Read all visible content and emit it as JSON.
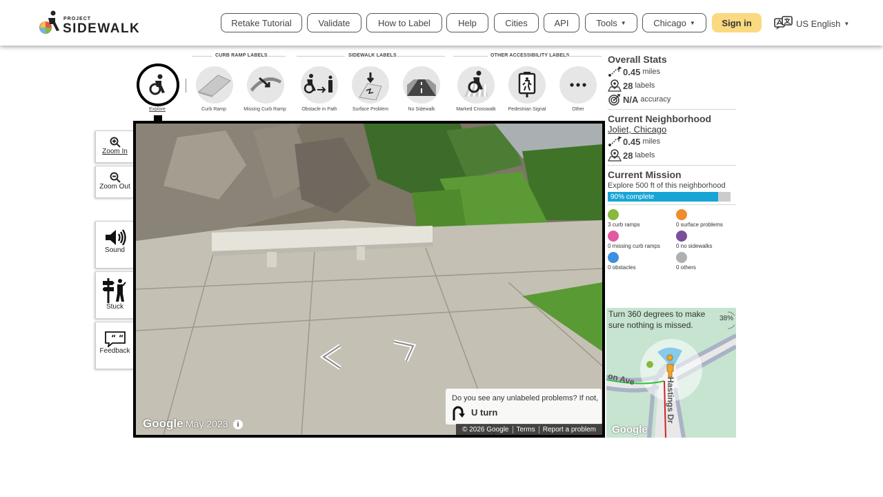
{
  "header": {
    "logo_small": "PROJECT",
    "logo_big": "SIDEWALK",
    "nav": [
      {
        "label": "Retake Tutorial"
      },
      {
        "label": "Validate"
      },
      {
        "label": "How to Label"
      },
      {
        "label": "Help"
      },
      {
        "label": "Cities"
      },
      {
        "label": "API"
      },
      {
        "label": "Tools"
      },
      {
        "label": "Chicago"
      }
    ],
    "signin": "Sign in",
    "language": "US English"
  },
  "toolbar": {
    "categories": [
      "CURB RAMP LABELS",
      "SIDEWALK LABELS",
      "OTHER ACCESSIBILITY LABELS"
    ],
    "tools": [
      {
        "label": "Explore",
        "icon": "explore-icon"
      },
      {
        "label": "Curb Ramp",
        "icon": "curb-ramp-icon"
      },
      {
        "label": "Missing Curb Ramp",
        "icon": "missing-curb-ramp-icon"
      },
      {
        "label": "Obstacle in Path",
        "icon": "obstacle-icon"
      },
      {
        "label": "Surface Problem",
        "icon": "surface-problem-icon"
      },
      {
        "label": "No Sidewalk",
        "icon": "no-sidewalk-icon"
      },
      {
        "label": "Marked Crosswalk",
        "icon": "crosswalk-icon"
      },
      {
        "label": "Pedestrian Signal",
        "icon": "pedestrian-signal-icon"
      },
      {
        "label": "Other",
        "icon": "more-icon"
      }
    ]
  },
  "side": {
    "zoom_in": "Zoom In",
    "zoom_out": "Zoom Out",
    "sound": "Sound",
    "stuck": "Stuck",
    "feedback": "Feedback"
  },
  "pano": {
    "watermark": "Google",
    "date": "May 2023",
    "info": "i",
    "footer": [
      "© 2026 Google",
      "Terms",
      "Report a problem"
    ],
    "uturn_question": "Do you see any unlabeled problems? If not,",
    "uturn_label": "U turn"
  },
  "stats": {
    "overall_title": "Overall Stats",
    "overall_miles": "0.45",
    "miles_unit": "miles",
    "overall_labels": "28",
    "labels_unit": "labels",
    "accuracy": "N/A",
    "accuracy_unit": "accuracy",
    "neighborhood_title": "Current Neighborhood",
    "neighborhood_name": "Joliet, Chicago",
    "neighborhood_miles": "0.45",
    "neighborhood_labels": "28",
    "mission_title": "Current Mission",
    "mission_text": "Explore 500 ft of this neighborhood",
    "mission_progress": 0.9,
    "mission_progress_text": "90% complete",
    "label_counts": [
      {
        "text": "3 curb ramps",
        "color": "#86b93c"
      },
      {
        "text": "0 surface problems",
        "color": "#f08b2e"
      },
      {
        "text": "0 missing curb ramps",
        "color": "#e35aa3"
      },
      {
        "text": "0 no sidewalks",
        "color": "#7a4f9c"
      },
      {
        "text": "0 obstacles",
        "color": "#3d8fe0"
      },
      {
        "text": "0 others",
        "color": "#b0b0b0"
      }
    ]
  },
  "minimap": {
    "prompt": "Turn 360 degrees to make sure nothing is missed.",
    "percent": "38%",
    "street1": "on Ave",
    "street2": "Hastings Dr",
    "watermark": "Google"
  }
}
